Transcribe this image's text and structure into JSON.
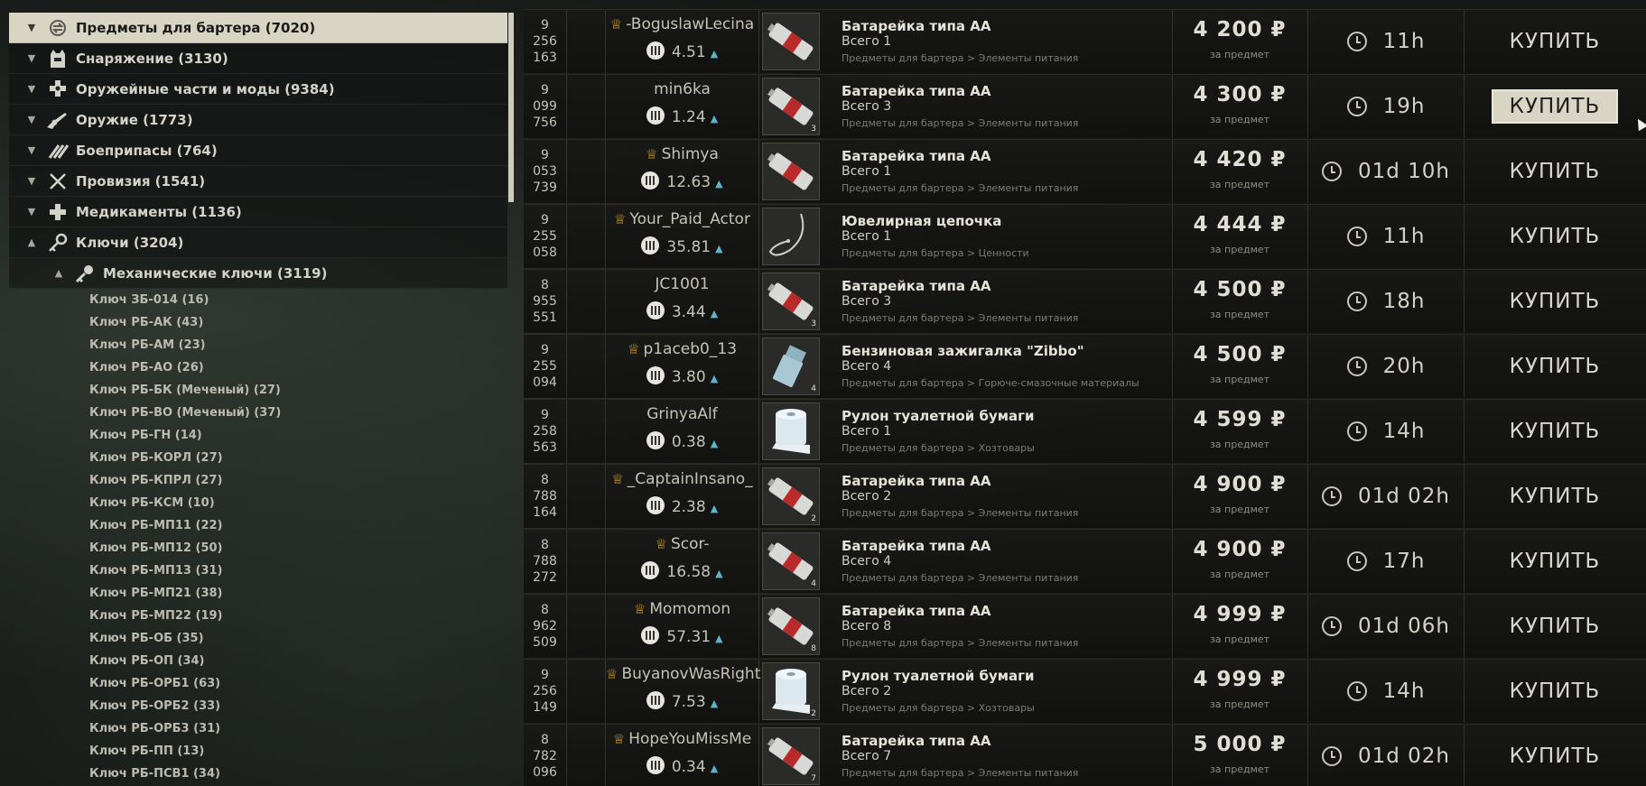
{
  "categories": [
    {
      "label": "Предметы для бартера (7020)",
      "icon": "barter-icon",
      "expanded": false,
      "active": true
    },
    {
      "label": "Снаряжение (3130)",
      "icon": "gear-vest-icon",
      "expanded": false,
      "active": false
    },
    {
      "label": "Оружейные части и моды (9384)",
      "icon": "weapon-mods-icon",
      "expanded": false,
      "active": false
    },
    {
      "label": "Оружие (1773)",
      "icon": "rifle-icon",
      "expanded": false,
      "active": false
    },
    {
      "label": "Боеприпасы (764)",
      "icon": "ammo-icon",
      "expanded": false,
      "active": false
    },
    {
      "label": "Провизия (1541)",
      "icon": "cutlery-icon",
      "expanded": false,
      "active": false
    },
    {
      "label": "Медикаменты (1136)",
      "icon": "medical-icon",
      "expanded": false,
      "active": false
    },
    {
      "label": "Ключи (3204)",
      "icon": "keys-icon",
      "expanded": true,
      "active": false
    }
  ],
  "subcategory": {
    "label": "Механические ключи (3119)",
    "icon": "key-icon",
    "expanded": true
  },
  "keys": [
    "Ключ ЗБ-014 (16)",
    "Ключ РБ-АК (43)",
    "Ключ РБ-АМ (23)",
    "Ключ РБ-АО (26)",
    "Ключ РБ-БК (Меченый) (27)",
    "Ключ РБ-ВО (Меченый) (37)",
    "Ключ РБ-ГН (14)",
    "Ключ РБ-КОРЛ (27)",
    "Ключ РБ-КПРЛ (27)",
    "Ключ РБ-КСМ (10)",
    "Ключ РБ-МП11 (22)",
    "Ключ РБ-МП12 (50)",
    "Ключ РБ-МП13 (31)",
    "Ключ РБ-МП21 (38)",
    "Ключ РБ-МП22 (19)",
    "Ключ РБ-ОБ (35)",
    "Ключ РБ-ОП (34)",
    "Ключ РБ-ОРБ1 (63)",
    "Ключ РБ-ОРБ2 (33)",
    "Ключ РБ-ОРБ3 (31)",
    "Ключ РБ-ПП (13)",
    "Ключ РБ-ПСВ1 (34)"
  ],
  "labels": {
    "per_item": "за предмет",
    "buy": "КУПИТЬ",
    "currency": "₽"
  },
  "offers": [
    {
      "id": [
        "9",
        "256",
        "163"
      ],
      "crown": true,
      "seller": "-BoguslawLecina",
      "rating": "4.51",
      "item": "Батарейка типа АА",
      "total": "Всего 1",
      "path": "Предметы для бартера > Элементы питания",
      "price": "4 200",
      "time": "11h",
      "thumb": "battery",
      "qty": ""
    },
    {
      "id": [
        "9",
        "099",
        "756"
      ],
      "crown": false,
      "seller": "min6ka",
      "rating": "1.24",
      "item": "Батарейка типа АА",
      "total": "Всего 3",
      "path": "Предметы для бартера > Элементы питания",
      "price": "4 300",
      "time": "19h",
      "thumb": "battery",
      "qty": "3"
    },
    {
      "id": [
        "9",
        "053",
        "739"
      ],
      "crown": true,
      "seller": "Shimya",
      "rating": "12.63",
      "item": "Батарейка типа АА",
      "total": "Всего 1",
      "path": "Предметы для бартера > Элементы питания",
      "price": "4 420",
      "time": "01d 10h",
      "thumb": "battery",
      "qty": ""
    },
    {
      "id": [
        "9",
        "255",
        "058"
      ],
      "crown": true,
      "seller": "Your_Paid_Actor",
      "rating": "35.81",
      "item": "Ювелирная цепочка",
      "total": "Всего 1",
      "path": "Предметы для бартера > Ценности",
      "price": "4 444",
      "time": "11h",
      "thumb": "chain",
      "qty": ""
    },
    {
      "id": [
        "8",
        "955",
        "551"
      ],
      "crown": false,
      "seller": "JC1001",
      "rating": "3.44",
      "item": "Батарейка типа АА",
      "total": "Всего 3",
      "path": "Предметы для бартера > Элементы питания",
      "price": "4 500",
      "time": "18h",
      "thumb": "battery",
      "qty": "3"
    },
    {
      "id": [
        "9",
        "255",
        "094"
      ],
      "crown": true,
      "seller": "p1aceb0_13",
      "rating": "3.80",
      "item": "Бензиновая зажигалка \"Zibbo\"",
      "total": "Всего 4",
      "path": "Предметы для бартера > Горюче-смазочные материалы",
      "price": "4 500",
      "time": "20h",
      "thumb": "lighter",
      "qty": "4"
    },
    {
      "id": [
        "9",
        "258",
        "563"
      ],
      "crown": false,
      "seller": "GrinyaAlf",
      "rating": "0.38",
      "item": "Рулон туалетной бумаги",
      "total": "Всего 1",
      "path": "Предметы для бартера > Хозтовары",
      "price": "4 599",
      "time": "14h",
      "thumb": "toilet-paper",
      "qty": ""
    },
    {
      "id": [
        "8",
        "788",
        "164"
      ],
      "crown": true,
      "seller": "_CaptainInsano_",
      "rating": "2.38",
      "item": "Батарейка типа АА",
      "total": "Всего 2",
      "path": "Предметы для бартера > Элементы питания",
      "price": "4 900",
      "time": "01d 02h",
      "thumb": "battery",
      "qty": "2"
    },
    {
      "id": [
        "8",
        "788",
        "272"
      ],
      "crown": true,
      "seller": "Scor-",
      "rating": "16.58",
      "item": "Батарейка типа АА",
      "total": "Всего 4",
      "path": "Предметы для бартера > Элементы питания",
      "price": "4 900",
      "time": "17h",
      "thumb": "battery",
      "qty": "4"
    },
    {
      "id": [
        "8",
        "962",
        "509"
      ],
      "crown": true,
      "seller": "Momomon",
      "rating": "57.31",
      "item": "Батарейка типа АА",
      "total": "Всего 8",
      "path": "Предметы для бартера > Элементы питания",
      "price": "4 999",
      "time": "01d 06h",
      "thumb": "battery",
      "qty": "8"
    },
    {
      "id": [
        "9",
        "256",
        "149"
      ],
      "crown": true,
      "seller": "BuyanovWasRight",
      "rating": "7.53",
      "item": "Рулон туалетной бумаги",
      "total": "Всего 2",
      "path": "Предметы для бартера > Хозтовары",
      "price": "4 999",
      "time": "14h",
      "thumb": "toilet-paper",
      "qty": "2"
    },
    {
      "id": [
        "8",
        "782",
        "096"
      ],
      "crown": true,
      "seller": "HopeYouMissMe",
      "rating": "0.34",
      "item": "Батарейка типа АА",
      "total": "Всего 7",
      "path": "Предметы для бартера > Элементы питания",
      "price": "5 000",
      "time": "01d 02h",
      "thumb": "battery",
      "qty": "7"
    }
  ],
  "hovered_offer": 1,
  "colors": {
    "crown": "#d6a52a",
    "rating_up": "#5fb3c8",
    "active_bg": "#d9d5c5"
  }
}
